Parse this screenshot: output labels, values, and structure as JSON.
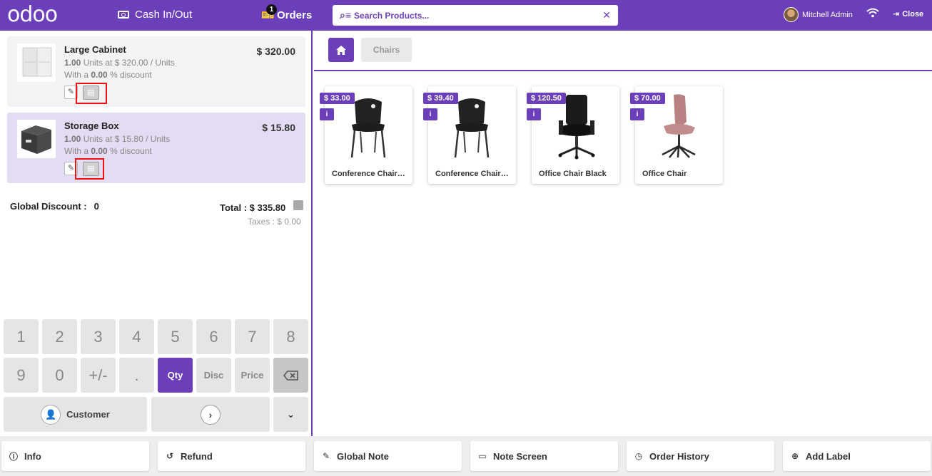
{
  "topbar": {
    "logo": "odoo",
    "cash_label": "Cash In/Out",
    "orders_label": "Orders",
    "orders_badge": "1",
    "search_placeholder": "Search Products...",
    "user_name": "Mitchell Admin",
    "close_label": "Close"
  },
  "order_lines": [
    {
      "name": "Large Cabinet",
      "qty": "1.00",
      "unit_text": "Units at $ 320.00 / Units",
      "disc_prefix": "With a",
      "disc": "0.00",
      "disc_suffix": "% discount",
      "price": "$ 320.00"
    },
    {
      "name": "Storage Box",
      "qty": "1.00",
      "unit_text": "Units at $ 15.80 / Units",
      "disc_prefix": "With a",
      "disc": "0.00",
      "disc_suffix": "% discount",
      "price": "$ 15.80"
    }
  ],
  "summary": {
    "global_discount_label": "Global Discount :",
    "global_discount_value": "0",
    "total": "Total : $ 335.80",
    "taxes": "Taxes : $ 0.00"
  },
  "numpad": {
    "row1": [
      "1",
      "2",
      "3",
      "4",
      "5",
      "6",
      "7",
      "8"
    ],
    "row2": [
      "9",
      "0",
      "+/-",
      ".",
      "Qty",
      "Disc",
      "Price"
    ],
    "customer_label": "Customer"
  },
  "breadcrumb": {
    "category": "Chairs"
  },
  "products": [
    {
      "price": "$ 33.00",
      "name": "Conference Chair (Steel frame)"
    },
    {
      "price": "$ 39.40",
      "name": "Conference Chair (Aluminium)"
    },
    {
      "price": "$ 120.50",
      "name": "Office Chair Black"
    },
    {
      "price": "$ 70.00",
      "name": "Office Chair"
    }
  ],
  "bottom_buttons": [
    "Info",
    "Refund",
    "Global Note",
    "Note Screen",
    "Order History",
    "Add Label"
  ],
  "colors": {
    "accent": "#6b3fb9",
    "selected_line": "#e4dcf2",
    "highlight": "#ee1111"
  }
}
